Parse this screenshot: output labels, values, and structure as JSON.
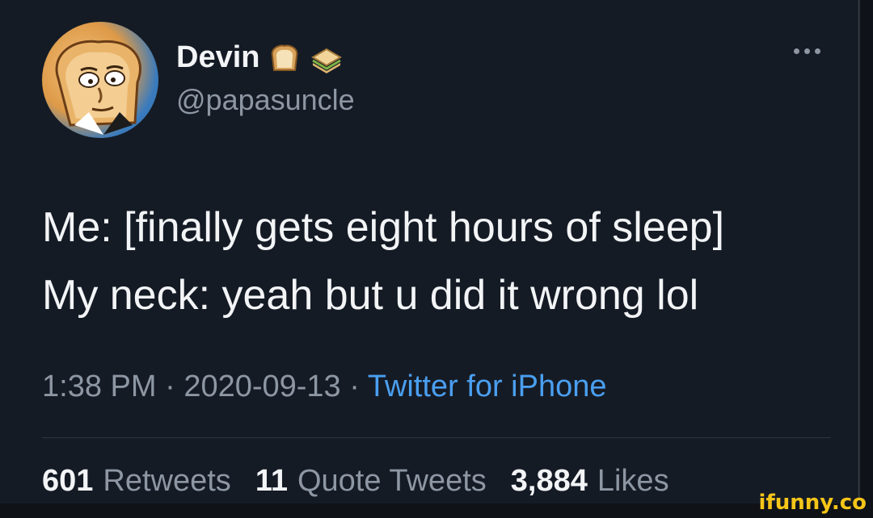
{
  "user": {
    "display_name": "Devin",
    "handle": "@papasuncle",
    "name_emojis": [
      "bread-icon",
      "sandwich-icon"
    ]
  },
  "tweet": {
    "lines": [
      "Me: [finally gets eight hours of sleep]",
      "My neck: yeah but u did it wrong lol"
    ],
    "time": "1:38 PM",
    "date": "2020-09-13",
    "source": "Twitter for iPhone"
  },
  "stats": {
    "retweets_count": "601",
    "retweets_label": "Retweets",
    "quotes_count": "11",
    "quotes_label": "Quote Tweets",
    "likes_count": "3,884",
    "likes_label": "Likes"
  },
  "watermark": "ifunny.co",
  "colors": {
    "background": "#151b25",
    "text": "#f2f4f6",
    "muted": "#8d97a3",
    "link": "#4a9ff0",
    "watermark": "#f5c518"
  }
}
